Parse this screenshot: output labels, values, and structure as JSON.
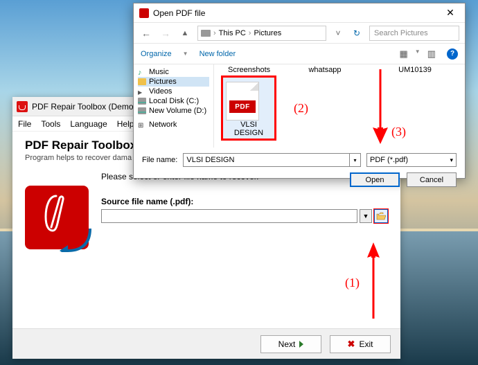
{
  "app": {
    "title": "PDF Repair Toolbox (Demo version)",
    "menu": [
      "File",
      "Tools",
      "Language",
      "Help"
    ],
    "heading": "PDF Repair Toolbox",
    "subheading": "Program helps to recover dama",
    "instruction": "Please select or enter file name to recover.",
    "field_label": "Source file name (.pdf):",
    "file_value": "",
    "next_label": "Next",
    "exit_label": "Exit"
  },
  "dialog": {
    "title": "Open PDF file",
    "breadcrumb": {
      "root": "This PC",
      "folder": "Pictures"
    },
    "search_placeholder": "Search Pictures",
    "organize": "Organize",
    "new_folder": "New folder",
    "tree": [
      {
        "icon": "music",
        "label": "Music"
      },
      {
        "icon": "folder",
        "label": "Pictures",
        "selected": true
      },
      {
        "icon": "video",
        "label": "Videos"
      },
      {
        "icon": "disk",
        "label": "Local Disk (C:)"
      },
      {
        "icon": "disk",
        "label": "New Volume (D:)"
      },
      {
        "icon": "network",
        "label": "Network"
      }
    ],
    "headers": [
      "Screenshots",
      "whatsapp",
      "UM10139"
    ],
    "selected_file": "VLSI DESIGN",
    "filename_label": "File name:",
    "filename_value": "VLSI DESIGN",
    "filetype": "PDF (*.pdf)",
    "open_label": "Open",
    "cancel_label": "Cancel"
  },
  "annotations": {
    "a1": "(1)",
    "a2": "(2)",
    "a3": "(3)"
  }
}
